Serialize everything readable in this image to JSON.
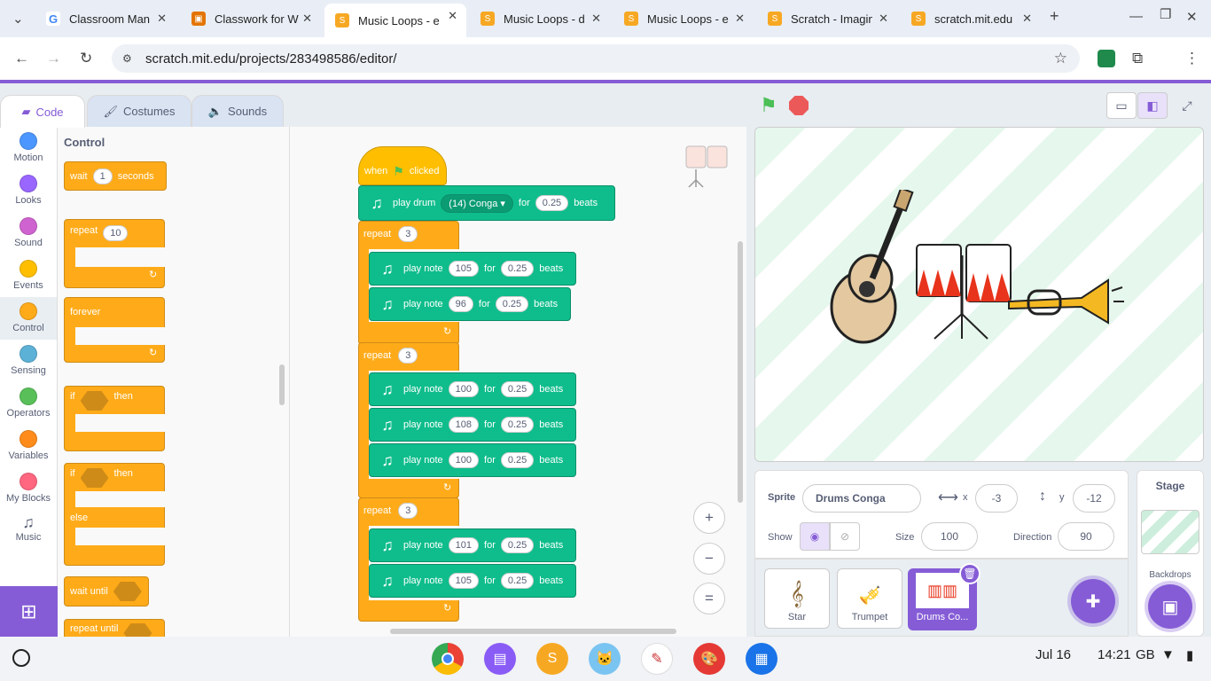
{
  "browser": {
    "tabs": [
      {
        "title": "Classroom Man",
        "icon": "google-g",
        "color": "#4285f4",
        "active": false
      },
      {
        "title": "Classwork for W",
        "icon": "classroom",
        "color": "#e37400",
        "active": false
      },
      {
        "title": "Music Loops - e",
        "icon": "scratch-s",
        "color": "#f7a823",
        "active": true
      },
      {
        "title": "Music Loops - d",
        "icon": "scratch-s",
        "color": "#f7a823",
        "active": false
      },
      {
        "title": "Music Loops - e",
        "icon": "scratch-s",
        "color": "#f7a823",
        "active": false
      },
      {
        "title": "Scratch - Imagin",
        "icon": "scratch-s",
        "color": "#f7a823",
        "active": false
      },
      {
        "title": "scratch.mit.edu",
        "icon": "scratch-s",
        "color": "#f7a823",
        "active": false
      }
    ],
    "url": "scratch.mit.edu/projects/283498586/editor/"
  },
  "editor": {
    "tabs": {
      "code": "Code",
      "costumes": "Costumes",
      "sounds": "Sounds"
    },
    "categories": [
      {
        "label": "Motion",
        "color": "#4c97ff"
      },
      {
        "label": "Looks",
        "color": "#9966ff"
      },
      {
        "label": "Sound",
        "color": "#cf63cf"
      },
      {
        "label": "Events",
        "color": "#ffbf00"
      },
      {
        "label": "Control",
        "color": "#ffab19"
      },
      {
        "label": "Sensing",
        "color": "#5cb1d6"
      },
      {
        "label": "Operators",
        "color": "#59c059"
      },
      {
        "label": "Variables",
        "color": "#ff8c1a"
      },
      {
        "label": "My Blocks",
        "color": "#ff6680"
      },
      {
        "label": "Music",
        "color": "#0fbd8c"
      }
    ],
    "palette": {
      "title": "Control",
      "wait": "wait",
      "wait_val": "1",
      "seconds": "seconds",
      "repeat": "repeat",
      "repeat_val": "10",
      "forever": "forever",
      "if": "if",
      "then": "then",
      "else": "else",
      "wait_until": "wait until",
      "repeat_until": "repeat until"
    },
    "script": {
      "hat_when": "when",
      "hat_clicked": "clicked",
      "play_drum": "play drum",
      "drum": "(14) Conga",
      "for": "for",
      "drum_beats": "0.25",
      "beats": "beats",
      "repeat": "repeat",
      "play_note": "play note",
      "loops": [
        {
          "times": "3",
          "notes": [
            {
              "note": "105",
              "beats": "0.25"
            },
            {
              "note": "96",
              "beats": "0.25"
            }
          ]
        },
        {
          "times": "3",
          "notes": [
            {
              "note": "100",
              "beats": "0.25"
            },
            {
              "note": "108",
              "beats": "0.25"
            },
            {
              "note": "100",
              "beats": "0.25"
            }
          ]
        },
        {
          "times": "3",
          "notes": [
            {
              "note": "101",
              "beats": "0.25"
            },
            {
              "note": "105",
              "beats": "0.25"
            }
          ]
        }
      ]
    },
    "zoom": {
      "in": "+",
      "out": "−",
      "reset": "="
    }
  },
  "sprite_info": {
    "sprite_label": "Sprite",
    "sprite_name": "Drums Conga",
    "x_label": "x",
    "x": "-3",
    "y_label": "y",
    "y": "-12",
    "show_label": "Show",
    "size_label": "Size",
    "size": "100",
    "direction_label": "Direction",
    "direction": "90"
  },
  "sprites": [
    {
      "name": "Star",
      "selected": false
    },
    {
      "name": "Trumpet",
      "selected": false
    },
    {
      "name": "Drums Co...",
      "selected": true
    }
  ],
  "stage_panel": {
    "title": "Stage",
    "backdrops": "Backdrops"
  },
  "taskbar": {
    "date": "Jul 16",
    "time": "14:21",
    "locale": "GB"
  }
}
